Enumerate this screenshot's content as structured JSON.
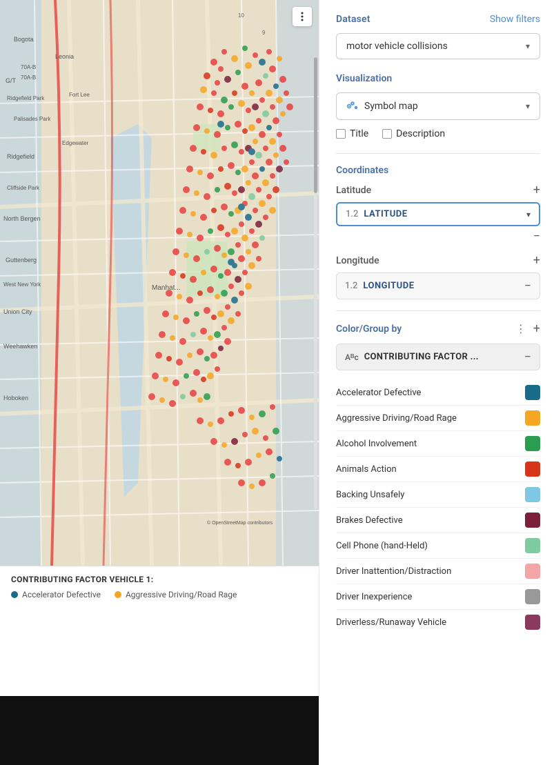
{
  "map": {
    "three_dots_label": "⋮",
    "legend_title": "CONTRIBUTING FACTOR VEHICLE 1:",
    "legend_items": [
      {
        "label": "Accelerator Defective",
        "color": "#1a6b8a"
      },
      {
        "label": "Aggressive Driving/Road Rage",
        "color": "#f5a623"
      }
    ]
  },
  "right_panel": {
    "dataset_label": "Dataset",
    "show_filters": "Show filters",
    "dataset_value": "motor vehicle collisions",
    "visualization_label": "Visualization",
    "viz_value": "Symbol map",
    "viz_icon": "symbol-map",
    "checkbox_title": "Title",
    "checkbox_description": "Description",
    "coordinates_label": "Coordinates",
    "latitude_label": "Latitude",
    "latitude_num": "1.2",
    "latitude_field": "LATITUDE",
    "longitude_label": "Longitude",
    "longitude_num": "1.2",
    "longitude_field": "LONGITUDE",
    "color_group_label": "Color/Group by",
    "contributing_field": "CONTRIBUTING FACTOR ...",
    "color_items": [
      {
        "label": "Accelerator Defective",
        "color": "#1a6b8a"
      },
      {
        "label": "Aggressive Driving/Road Rage",
        "color": "#f5a623"
      },
      {
        "label": "Alcohol Involvement",
        "color": "#2a9d4e"
      },
      {
        "label": "Animals Action",
        "color": "#d9341a"
      },
      {
        "label": "Backing Unsafely",
        "color": "#7ec8e3"
      },
      {
        "label": "Brakes Defective",
        "color": "#7b1f3a"
      },
      {
        "label": "Cell Phone (hand-Held)",
        "color": "#7ecba0"
      },
      {
        "label": "Driver Inattention/Distraction",
        "color": "#f4a6a6"
      },
      {
        "label": "Driver Inexperience",
        "color": "#999999"
      },
      {
        "label": "Driverless/Runaway Vehicle",
        "color": "#8b3a5e"
      }
    ]
  }
}
